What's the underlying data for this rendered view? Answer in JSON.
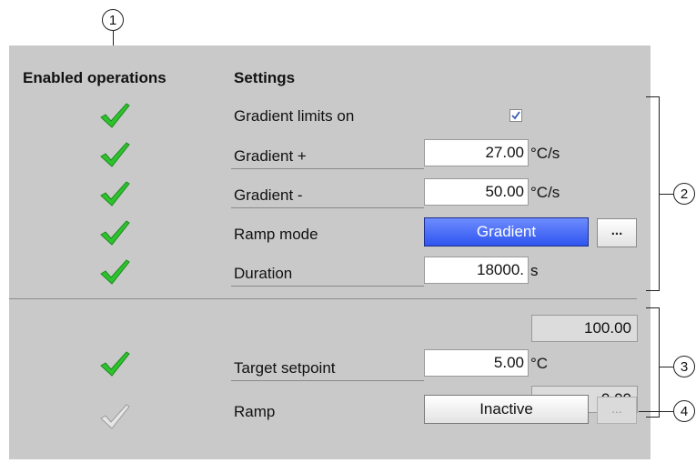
{
  "headers": {
    "enabled": "Enabled operations",
    "settings": "Settings"
  },
  "rows": {
    "gradient_limits": {
      "label": "Gradient limits on",
      "checked": true
    },
    "gradient_plus": {
      "label": "Gradient +",
      "value": "27.00",
      "unit": "°C/s"
    },
    "gradient_minus": {
      "label": "Gradient -",
      "value": "50.00",
      "unit": "°C/s"
    },
    "ramp_mode": {
      "label": "Ramp mode",
      "value": "Gradient",
      "more": "..."
    },
    "duration": {
      "label": "Duration",
      "value": "18000.",
      "unit": "s"
    },
    "target_high": "100.00",
    "target_setpoint": {
      "label": "Target setpoint",
      "value": "5.00",
      "unit": "°C"
    },
    "target_low": "0.00",
    "ramp": {
      "label": "Ramp",
      "value": "Inactive",
      "more": "..."
    }
  },
  "callouts": {
    "c1": "1",
    "c2": "2",
    "c3": "3",
    "c4": "4"
  },
  "colors": {
    "panel": "#c9c9c9",
    "accent_blue": "#3e64f2",
    "check_green": "#2ec22e",
    "check_disabled": "#a9a9a9"
  }
}
